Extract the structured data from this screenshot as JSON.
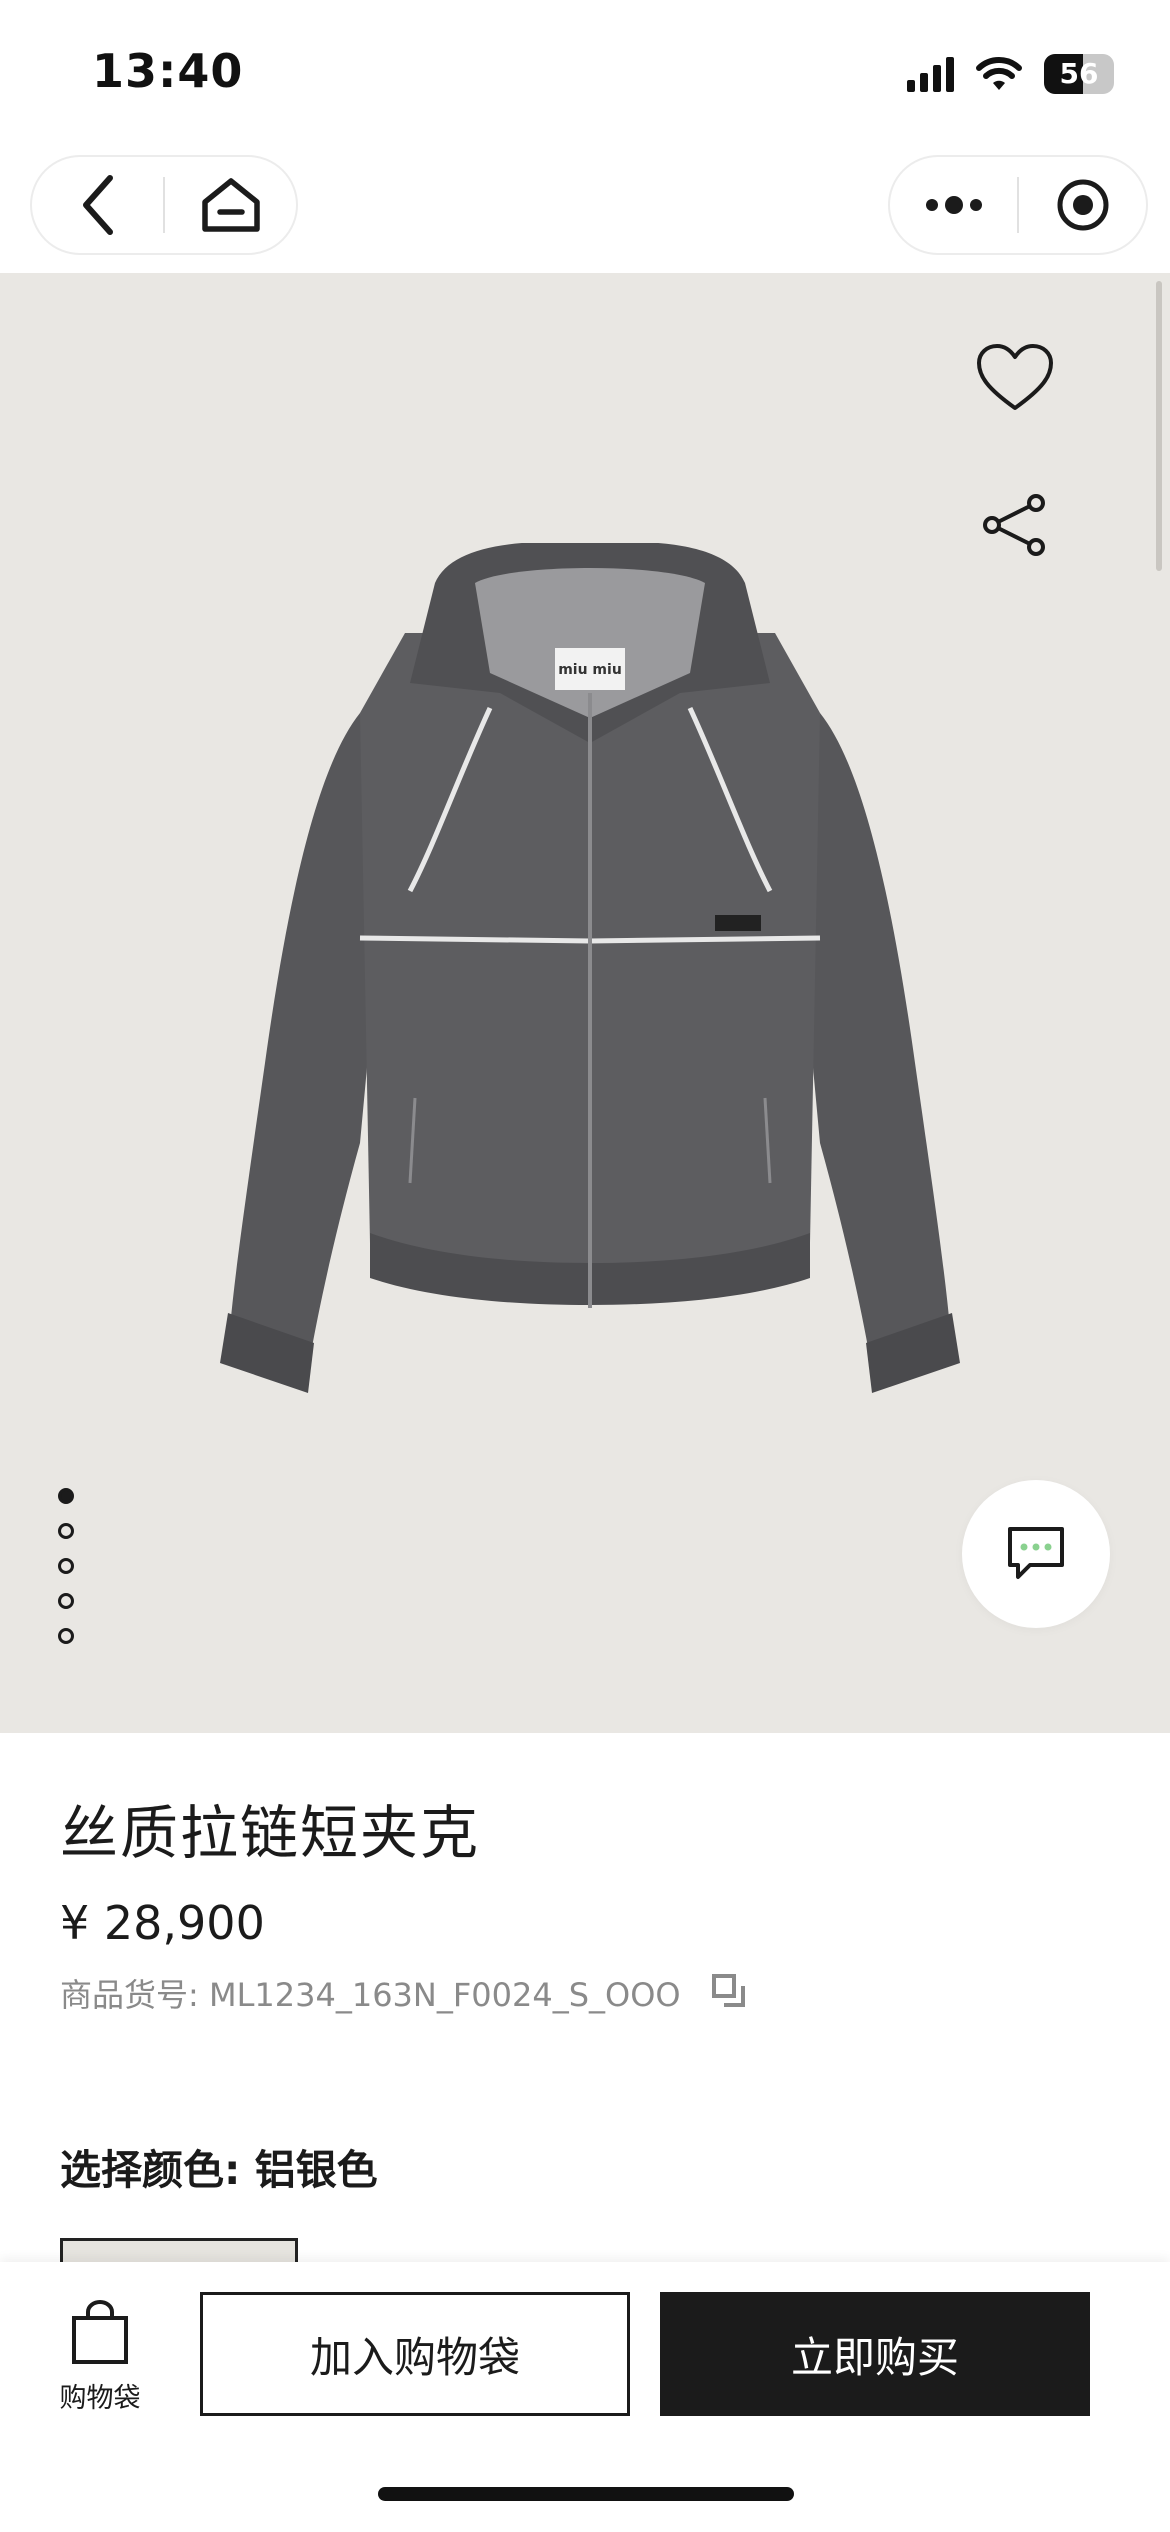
{
  "status_bar": {
    "time": "13:40",
    "battery_level": "56",
    "icons": [
      "cellular-signal-icon",
      "wifi-icon",
      "battery-icon"
    ]
  },
  "nav": {
    "left_icons": [
      "back-arrow-icon",
      "home-icon"
    ],
    "right_icons": [
      "more-dots-icon",
      "close-target-icon"
    ]
  },
  "hero": {
    "background_color": "#e9e7e3",
    "image_label": "miu miu",
    "image_count": 5,
    "active_image_index": 0,
    "icons": [
      "heart-icon",
      "share-icon",
      "chat-bubble-icon"
    ]
  },
  "product": {
    "title": "丝质拉链短夹克",
    "price": "¥ 28,900",
    "sku": "商品货号: ML1234_163N_F0024_S_OOO",
    "color_label": "选择颜色: 铝银色"
  },
  "bottom_bar": {
    "cart_label": "购物袋",
    "add_to_cart": "加入购物袋",
    "buy_now": "立即购买"
  },
  "colors": {
    "primary_dark": "#1b1b1b",
    "hero_bg": "#e9e7e3",
    "muted_text": "#8a8a8a"
  }
}
